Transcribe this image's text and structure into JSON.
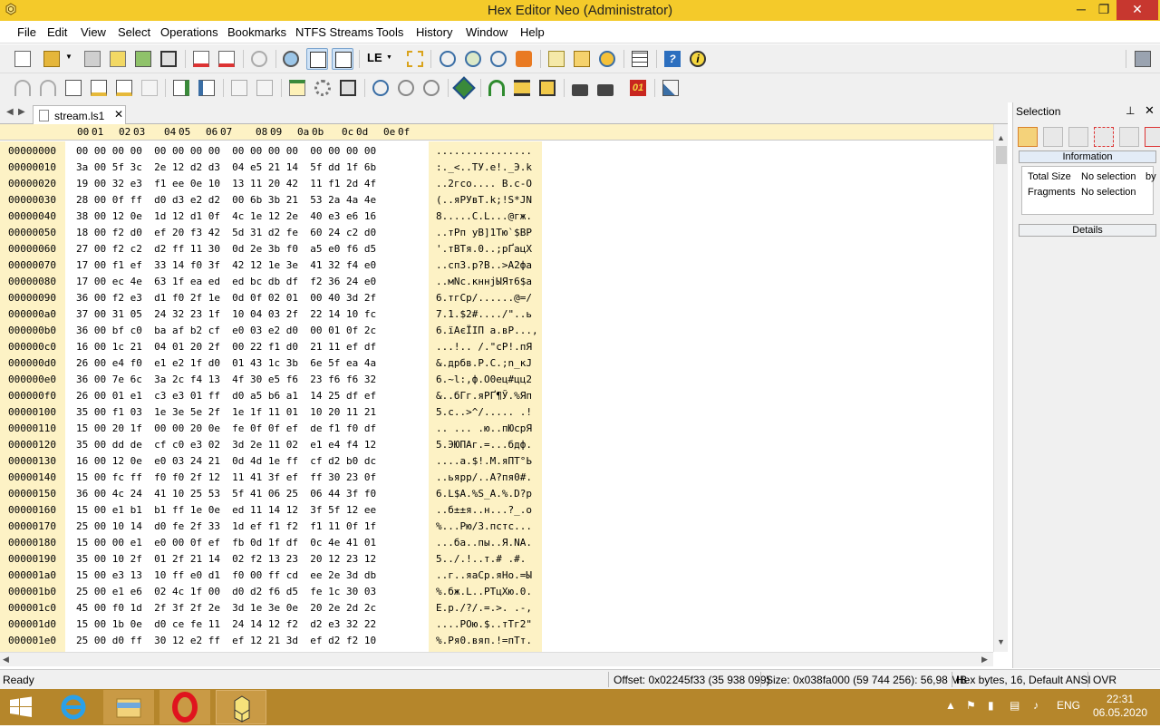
{
  "window": {
    "title": "Hex Editor Neo (Administrator)",
    "minimize": "─",
    "maximize": "❐",
    "close": "✕",
    "app_icon": "hex-cells-icon"
  },
  "menu": [
    "File",
    "Edit",
    "View",
    "Select",
    "Operations",
    "Bookmarks",
    "NTFS Streams",
    "Tools",
    "History",
    "Window",
    "Help"
  ],
  "toolbar1_icons": [
    "new-file-icon",
    "open-file-icon",
    "open-dropdown-icon",
    "save-icon",
    "save-as-icon",
    "save-all-icon",
    "print-icon",
    "close-document-icon",
    "close-all-icon",
    "refresh-icon",
    "pattern-coloring-icon",
    "info-bar-icon",
    "text-view-icon",
    "endian-le-icon",
    "multiple-select-icon",
    "find-icon",
    "find-all-icon",
    "replace-icon",
    "plugin-icon",
    "calculator-icon",
    "checksum-icon",
    "api-icon",
    "structure-viewer-icon",
    "help-icon",
    "about-icon",
    "settings-icon"
  ],
  "toolbar2_icons": [
    "undo-icon",
    "redo-icon",
    "edit-icon",
    "insert-icon",
    "fill-icon",
    "delete-icon",
    "copy-as-icon",
    "export-icon",
    "copy-icon",
    "paste-icon",
    "goto-icon",
    "settings-gear-icon",
    "printer-icon",
    "zoom-in-icon",
    "zoom-out-icon",
    "zoom-reset-icon",
    "pin-icon",
    "bookmark-icon",
    "go-to-bookmark-icon",
    "select-block-icon",
    "lock-icon",
    "unlock-icon",
    "binary-01-icon",
    "highlighter-icon"
  ],
  "tab": {
    "label": "stream.ls1",
    "close": "✕",
    "nav_left": "◀",
    "nav_right": "▶"
  },
  "colors": {
    "title_bar": "#f4ca2a",
    "header_bg": "#fdf2c5",
    "close_button": "#c7372f",
    "taskbar": "#b5862b"
  },
  "hex": {
    "column_headers": [
      "00",
      "01",
      "02",
      "03",
      "04",
      "05",
      "06",
      "07",
      "08",
      "09",
      "0a",
      "0b",
      "0c",
      "0d",
      "0e",
      "0f"
    ],
    "rows": [
      {
        "offset": "00000000",
        "bytes": "00 00 00 00  00 00 00 00  00 00 00 00  00 00 00 00",
        "ascii": "................"
      },
      {
        "offset": "00000010",
        "bytes": "3a 00 5f 3c  2e 12 d2 d3  04 e5 21 14  5f dd 1f 6b",
        "ascii": ":._<..ТУ.е!._Э.k"
      },
      {
        "offset": "00000020",
        "bytes": "19 00 32 e3  f1 ee 0e 10  13 11 20 42  11 f1 2d 4f",
        "ascii": "..2гсо.... B.с-O"
      },
      {
        "offset": "00000030",
        "bytes": "28 00 0f ff  d0 d3 e2 d2  00 6b 3b 21  53 2a 4a 4e",
        "ascii": "(..яРУвТ.k;!S*JN"
      },
      {
        "offset": "00000040",
        "bytes": "38 00 12 0e  1d 12 d1 0f  4c 1e 12 2e  40 e3 e6 16",
        "ascii": "8.....С.L...@гж."
      },
      {
        "offset": "00000050",
        "bytes": "18 00 f2 d0  ef 20 f3 42  5d 31 d2 fe  60 24 c2 d0",
        "ascii": "..тРп уB]1Тю`$ВР"
      },
      {
        "offset": "00000060",
        "bytes": "27 00 f2 c2  d2 ff 11 30  0d 2e 3b f0  a5 e0 f6 d5",
        "ascii": "'.тВТя.0..;рҐацХ"
      },
      {
        "offset": "00000070",
        "bytes": "17 00 f1 ef  33 14 f0 3f  42 12 1e 3e  41 32 f4 e0",
        "ascii": "..сп3.р?B..>A2фа"
      },
      {
        "offset": "00000080",
        "bytes": "17 00 ec 4e  63 1f ea ed  ed bc db df  f2 36 24 e0",
        "ascii": "..мNc.кннјЫЯт6$а"
      },
      {
        "offset": "00000090",
        "bytes": "36 00 f2 e3  d1 f0 2f 1e  0d 0f 02 01  00 40 3d 2f",
        "ascii": "6.тгСр/......@=/"
      },
      {
        "offset": "000000a0",
        "bytes": "37 00 31 05  24 32 23 1f  10 04 03 2f  22 14 10 fc",
        "ascii": "7.1.$2#..../\"..ь"
      },
      {
        "offset": "000000b0",
        "bytes": "36 00 bf c0  ba af b2 cf  e0 03 e2 d0  00 01 0f 2c",
        "ascii": "6.їАєЇІП а.вР...,"
      },
      {
        "offset": "000000c0",
        "bytes": "16 00 1c 21  04 01 20 2f  00 22 f1 d0  21 11 ef df",
        "ascii": "...!.. /.\"сР!.пЯ"
      },
      {
        "offset": "000000d0",
        "bytes": "26 00 e4 f0  e1 e2 1f d0  01 43 1c 3b  6e 5f ea 4a",
        "ascii": "&.дрбв.Р.C.;n_кJ"
      },
      {
        "offset": "000000e0",
        "bytes": "36 00 7e 6c  3a 2c f4 13  4f 30 e5 f6  23 f6 f6 32",
        "ascii": "6.~l:,ф.O0ец#цц2"
      },
      {
        "offset": "000000f0",
        "bytes": "26 00 01 e1  c3 e3 01 ff  d0 a5 b6 a1  14 25 df ef",
        "ascii": "&..бГг.яРҐ¶Ў.%Яп"
      },
      {
        "offset": "00000100",
        "bytes": "35 00 f1 03  1e 3e 5e 2f  1e 1f 11 01  10 20 11 21",
        "ascii": "5.с..>^/..... .!"
      },
      {
        "offset": "00000110",
        "bytes": "15 00 20 1f  00 00 20 0e  fe 0f 0f ef  de f1 f0 df",
        "ascii": ".. ... .ю..пЮсрЯ"
      },
      {
        "offset": "00000120",
        "bytes": "35 00 dd de  cf c0 e3 02  3d 2e 11 02  e1 e4 f4 12",
        "ascii": "5.ЭЮПАг.=...бдф."
      },
      {
        "offset": "00000130",
        "bytes": "16 00 12 0e  e0 03 24 21  0d 4d 1e ff  cf d2 b0 dc",
        "ascii": "....а.$!.M.яПТ°Ь"
      },
      {
        "offset": "00000140",
        "bytes": "15 00 fc ff  f0 f0 2f 12  11 41 3f ef  ff 30 23 0f",
        "ascii": "..ьярр/..A?пя0#."
      },
      {
        "offset": "00000150",
        "bytes": "36 00 4c 24  41 10 25 53  5f 41 06 25  06 44 3f f0",
        "ascii": "6.L$A.%S_A.%.D?р"
      },
      {
        "offset": "00000160",
        "bytes": "15 00 e1 b1  b1 ff 1e 0e  ed 11 14 12  3f 5f 12 ee",
        "ascii": "..б±±я..н...?_.о"
      },
      {
        "offset": "00000170",
        "bytes": "25 00 10 14  d0 fe 2f 33  1d ef f1 f2  f1 11 0f 1f",
        "ascii": "%...Рю/3.пстс..."
      },
      {
        "offset": "00000180",
        "bytes": "15 00 00 e1  e0 00 0f ef  fb 0d 1f df  0c 4e 41 01",
        "ascii": "...ба..пы..Я.NA."
      },
      {
        "offset": "00000190",
        "bytes": "35 00 10 2f  01 2f 21 14  02 f2 13 23  20 12 23 12",
        "ascii": "5../.!..т.# .#."
      },
      {
        "offset": "000001a0",
        "bytes": "15 00 e3 13  10 ff e0 d1  f0 00 ff cd  ee 2e 3d db",
        "ascii": "..г..яаСр.яНо.=Ы"
      },
      {
        "offset": "000001b0",
        "bytes": "25 00 e1 e6  02 4c 1f 00  d0 d2 f6 d5  fe 1c 30 03",
        "ascii": "%.бж.L..РТцХю.0."
      },
      {
        "offset": "000001c0",
        "bytes": "45 00 f0 1d  2f 3f 2f 2e  3d 1e 3e 0e  20 2e 2d 2c",
        "ascii": "E.р./?/.=.>. .-,"
      },
      {
        "offset": "000001d0",
        "bytes": "15 00 1b 0e  d0 ce fe 11  24 14 12 f2  d2 e3 32 22",
        "ascii": "....РОю.$..тТг2\""
      },
      {
        "offset": "000001e0",
        "bytes": "25 00 d0 ff  30 12 e2 ff  ef 12 21 3d  ef d2 f2 10",
        "ascii": "%.Ря0.вяп.!=пТт."
      }
    ]
  },
  "panel": {
    "title": "Selection",
    "pin": "📌",
    "close": "✕",
    "info_label": "Information",
    "details_label": "Details",
    "info_rows": [
      {
        "label": "Total Size",
        "value": "No selection",
        "extra": "by"
      },
      {
        "label": "Fragments",
        "value": "No selection"
      }
    ]
  },
  "status": {
    "ready": "Ready",
    "offset": "Offset: 0x02245f33 (35 938 099)",
    "size": "Size: 0x038fa000 (59 744 256): 56,98 MB",
    "mode": "Hex bytes, 16, Default ANSI",
    "ovr": "OVR"
  },
  "taskbar": {
    "language": "ENG",
    "time": "22:31",
    "date": "06.05.2020"
  }
}
